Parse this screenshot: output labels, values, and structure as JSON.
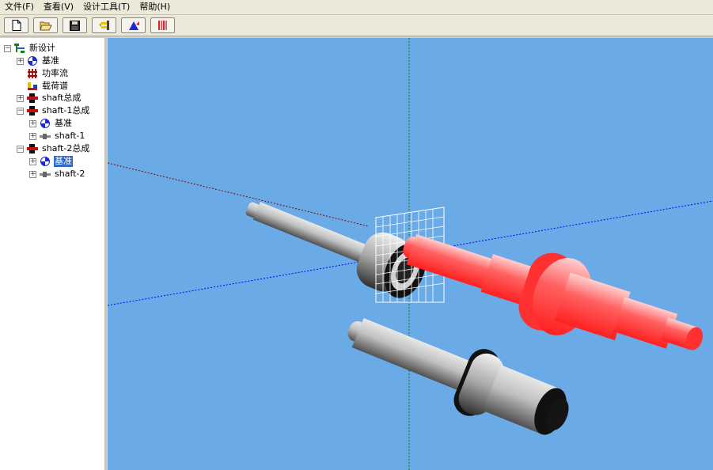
{
  "menu": {
    "items": [
      "文件(F)",
      "查看(V)",
      "设计工具(T)",
      "帮助(H)"
    ]
  },
  "toolbar": {
    "buttons": [
      {
        "name": "new-button",
        "icon": "blank-document-icon"
      },
      {
        "name": "open-button",
        "icon": "open-folder-icon"
      },
      {
        "name": "save-button",
        "icon": "floppy-disk-icon"
      },
      {
        "name": "power-flow-button",
        "icon": "power-flow-icon"
      },
      {
        "name": "datum-button",
        "icon": "datum-icon"
      },
      {
        "name": "load-spectrum-button",
        "icon": "load-spectrum-icon"
      }
    ]
  },
  "tree": {
    "root": "新设计",
    "datum": "基准",
    "power_flow": "功率流",
    "load_spectrum": "载荷谱",
    "shaft_assembly": "shaft总成",
    "shaft1_assembly": "shaft-1总成",
    "shaft1_datum": "基准",
    "shaft1": "shaft-1",
    "shaft2_assembly": "shaft-2总成",
    "shaft2_datum": "基准",
    "shaft2": "shaft-2",
    "selected": "shaft2_datum"
  },
  "viewport": {
    "background": "#6aaae6",
    "x_axis_color": "#0000ff",
    "y_axis_color": "#008000",
    "z_axis_color": "#8b0000",
    "shaft_colors": {
      "gray": "#b8b8b8",
      "red": "#ff4040"
    }
  }
}
